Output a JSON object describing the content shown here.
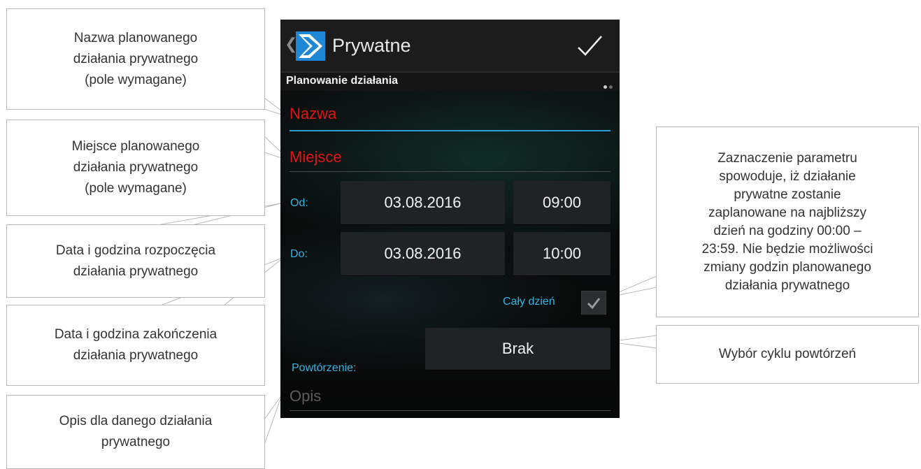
{
  "app": {
    "title": "Prywatne",
    "section_title": "Planowanie działania",
    "fields": {
      "name_placeholder": "Nazwa",
      "place_placeholder": "Miejsce",
      "description_placeholder": "Opis"
    },
    "from": {
      "label": "Od:",
      "date": "03.08.2016",
      "time": "09:00"
    },
    "to": {
      "label": "Do:",
      "date": "03.08.2016",
      "time": "10:00"
    },
    "all_day": {
      "label": "Cały dzień",
      "checked": true
    },
    "repeat": {
      "label": "Powtórzenie:",
      "value": "Brak"
    },
    "colors": {
      "required_text": "#e41414",
      "accent": "#33b5e5",
      "background": "#0b0c0d"
    },
    "icons": {
      "back": "chevron-left-icon",
      "logo": "app-logo-icon",
      "confirm": "checkmark-icon",
      "checkbox": "checkbox-checked-icon"
    }
  },
  "callouts": {
    "name": [
      "Nazwa planowanego",
      "działania prywatnego",
      "(pole wymagane)"
    ],
    "place": [
      "Miejsce planowanego",
      "działania prywatnego",
      "(pole wymagane)"
    ],
    "start": [
      "Data i godzina rozpoczęcia",
      "działania prywatnego"
    ],
    "end": [
      "Data i godzina zakończenia",
      "działania prywatnego"
    ],
    "description": [
      "Opis dla danego działania",
      "prywatnego"
    ],
    "all_day": [
      "Zaznaczenie parametru",
      "spowoduje, iż działanie",
      "prywatne zostanie",
      "zaplanowane na najbliższy",
      "dzień na godziny 00:00 –",
      "23:59. Nie będzie możliwości",
      "zmiany godzin planowanego",
      "działania prywatnego"
    ],
    "repeat": [
      "Wybór cyklu powtórzeń"
    ]
  }
}
